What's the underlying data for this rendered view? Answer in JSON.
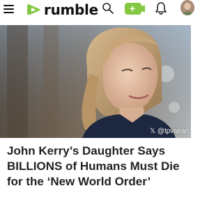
{
  "header": {
    "brand": "rumble",
    "icons": [
      "menu-icon",
      "rumble-logo-icon",
      "search-icon",
      "upload-video-icon",
      "bell-icon",
      "avatar"
    ],
    "brand_color": "#85c742"
  },
  "article": {
    "image_credit": "𝕏 @tpvsean",
    "headline": "John Kerry’s Daughter Says BILLIONS of Humans Must Die for the ‘New World Order’"
  }
}
